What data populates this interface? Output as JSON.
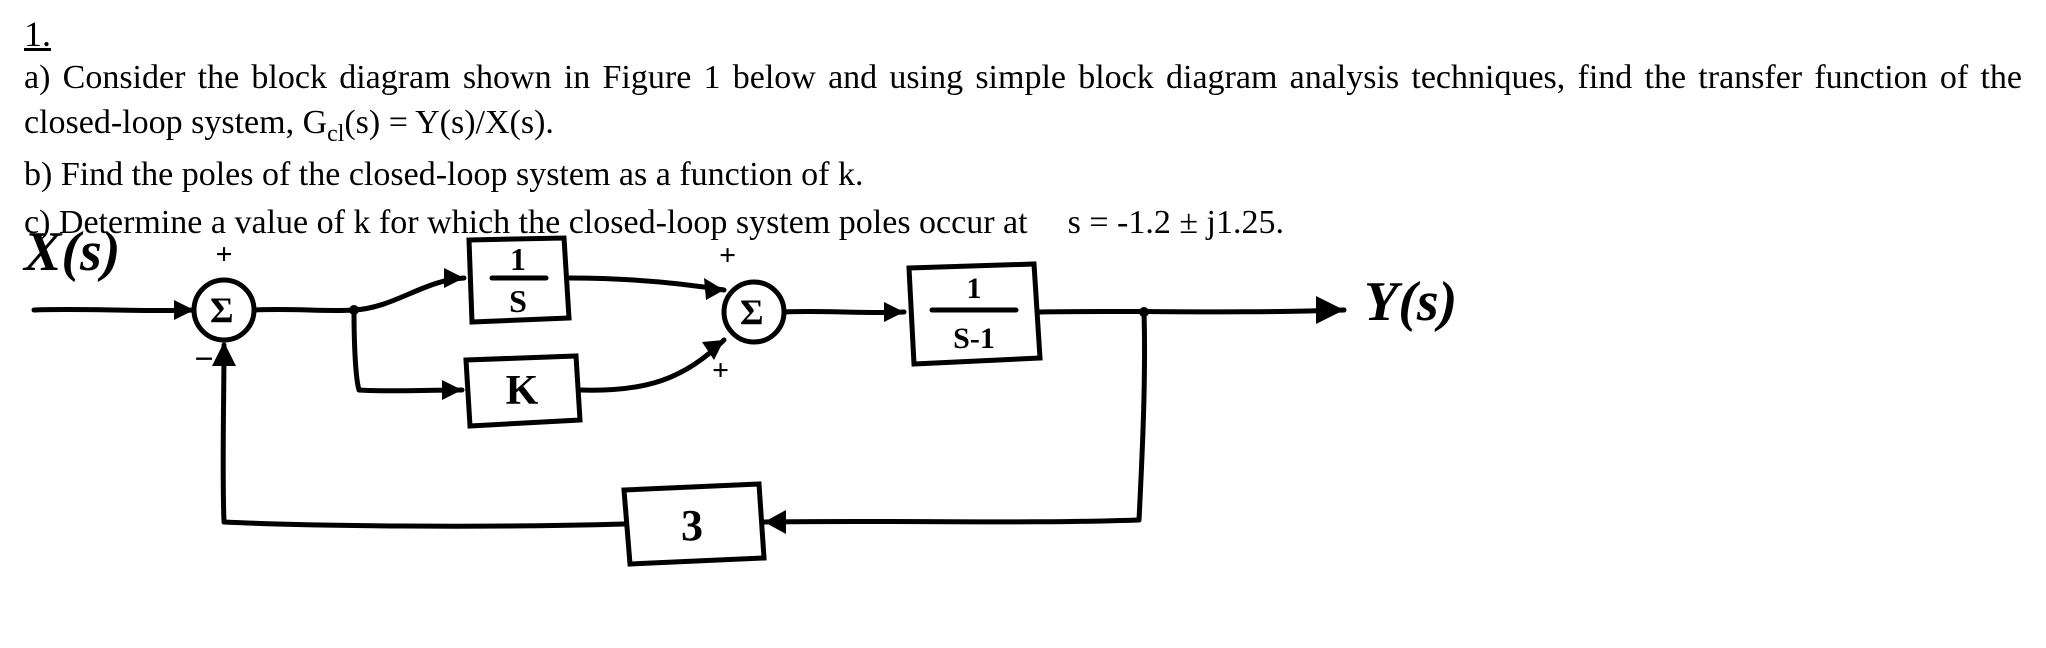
{
  "question_number": "1.",
  "parts": {
    "a": "a) Consider the block diagram shown in Figure 1 below and using simple block diagram analysis techniques, find the transfer function of the closed-loop system, G",
    "a_sub": "cl",
    "a_after": "(s) = Y(s)/X(s).",
    "b": "b) Find the poles of the closed-loop system as a function of k.",
    "c_pre": "c) Determine a value of k for which the closed-loop system poles occur at",
    "c_eq": "s = -1.2 ± j1.25."
  },
  "diagram": {
    "input_label": "X(s)",
    "output_label": "Y(s)",
    "block1_num": "1",
    "block1_den": "S",
    "block_k": "K",
    "block2_num": "1",
    "block2_den": "S-1",
    "feedback_gain": "3",
    "sum1_top_sign": "+",
    "sum1_bottom_sign": "−",
    "sum2_top_sign": "+",
    "sum2_bottom_sign": "+"
  }
}
